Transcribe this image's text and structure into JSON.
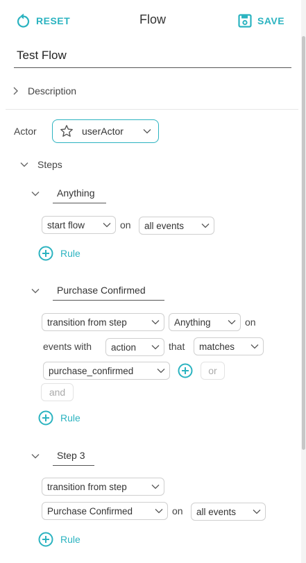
{
  "header": {
    "reset_label": "RESET",
    "title": "Flow",
    "save_label": "SAVE"
  },
  "flow": {
    "name": "Test Flow"
  },
  "description": {
    "label": "Description"
  },
  "actor": {
    "label": "Actor",
    "value": "userActor"
  },
  "steps_label": "Steps",
  "steps": [
    {
      "title": "Anything",
      "trigger": "start flow",
      "on_label": "on",
      "events": "all events",
      "rule_label": "Rule"
    },
    {
      "title": "Purchase Confirmed",
      "trigger": "transition from step",
      "from_step": "Anything",
      "on_label": "on",
      "events_with_label": "events with",
      "field": "action",
      "that_label": "that",
      "operator": "matches",
      "value": "purchase_confirmed",
      "or_label": "or",
      "and_label": "and",
      "rule_label": "Rule"
    },
    {
      "title": "Step 3",
      "trigger": "transition from step",
      "from_step": "Purchase Confirmed",
      "on_label": "on",
      "events": "all events",
      "rule_label": "Rule"
    }
  ],
  "colors": {
    "accent": "#2bb3c0",
    "text": "#333333",
    "border": "#cfcfcf",
    "disabled": "#aaaaaa"
  },
  "icons": {
    "reset": "reset-icon",
    "save": "save-icon",
    "actor": "star-icon",
    "add": "plus-circle-icon",
    "chevron": "chevron-down-icon"
  }
}
